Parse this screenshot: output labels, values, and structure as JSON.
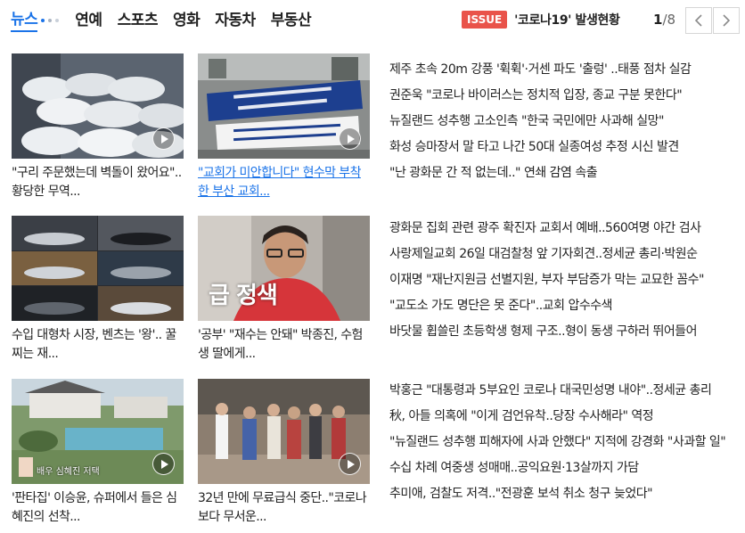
{
  "nav": {
    "tabs": [
      "뉴스",
      "연예",
      "스포츠",
      "영화",
      "자동차",
      "부동산"
    ]
  },
  "issue": {
    "badge": "ISSUE",
    "text": "'코로나19' 발생현황"
  },
  "pager": {
    "current": "1",
    "separator": "/",
    "total": "8"
  },
  "cards": [
    {
      "title": "\"구리 주문했는데 벽돌이 왔어요\"..황당한 무역...",
      "has_video": true
    },
    {
      "title": "\"교회가 미안합니다\" 현수막 부착한 부산 교회...",
      "has_video": true
    },
    {
      "title": "수입 대형차 시장, 벤츠는 '왕'.. 꿀찌는 재...",
      "has_video": false
    },
    {
      "title": "'공부' \"재수는 안돼\" 박종진, 수험생 딸에게...",
      "has_video": false,
      "overlay": "급 정색"
    },
    {
      "title": "'판타집' 이승윤, 슈퍼에서 들은 심혜진의 선착...",
      "has_video": true,
      "overlay": "배우 심혜진 저택"
    },
    {
      "title": "32년 만에 무료급식 중단..\"코로나보다 무서운...",
      "has_video": true
    }
  ],
  "headlines": [
    [
      "제주 초속 20m 강풍 '휙휙'·거센 파도 '출렁' ..태풍 점차 실감",
      "권준욱 \"코로나 바이러스는 정치적 입장, 종교 구분 못한다\"",
      "뉴질랜드 성추행 고소인측 \"한국 국민에만 사과해 실망\"",
      "화성 승마장서 말 타고 나간 50대 실종여성 추정 시신 발견",
      "\"난 광화문 간 적 없는데..\" 연쇄 감염 속출"
    ],
    [
      "광화문 집회 관련 광주 확진자 교회서 예배..560여명 야간 검사",
      "사랑제일교회 26일 대검찰청 앞 기자회견..정세균 총리·박원순",
      "이재명 \"재난지원금 선별지원, 부자 부담증가 막는 교묘한 꼼수\"",
      "\"교도소 가도 명단은 못 준다\"..교회 압수수색",
      "바닷물 휩쓸린 초등학생 형제 구조..형이 동생 구하러 뛰어들어"
    ],
    [
      "박홍근 \"대통령과 5부요인 코로나 대국민성명 내야\"..정세균 총리",
      "秋, 아들 의혹에 \"이게 검언유착..당장 수사해라\" 역정",
      "\"뉴질랜드 성추행 피해자에 사과 안했다\" 지적에 강경화 \"사과할 일\"",
      "수십 차례 여중생 성매매..공익요원·13살까지 가담",
      "추미애, 검찰도 저격..\"전광훈 보석 취소 청구 늦었다\""
    ]
  ],
  "colors": {
    "accent": "#1a73e8",
    "issue_badge": "#e9534a"
  }
}
